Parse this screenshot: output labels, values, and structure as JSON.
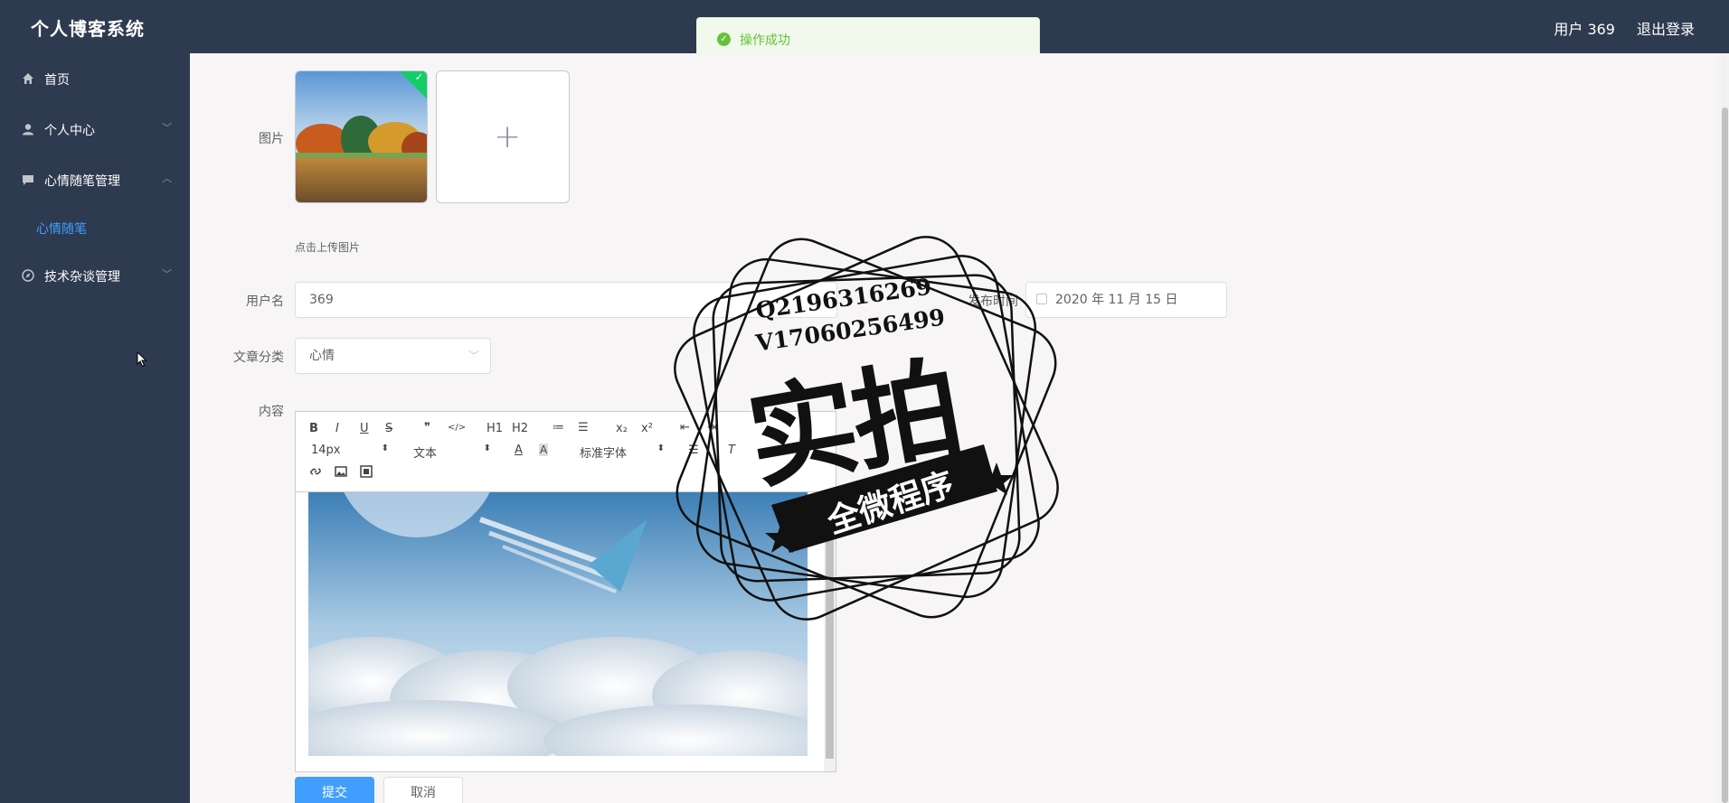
{
  "header": {
    "brand": "个人博客系统",
    "user": "用户 369",
    "logout": "退出登录"
  },
  "toast": {
    "message": "操作成功",
    "type": "success"
  },
  "sidebar": {
    "items": [
      {
        "label": "首页",
        "icon": "home-icon",
        "expandable": false
      },
      {
        "label": "个人中心",
        "icon": "user-icon",
        "expandable": true,
        "expanded": false
      },
      {
        "label": "心情随笔管理",
        "icon": "chat-icon",
        "expandable": true,
        "expanded": true,
        "children": [
          {
            "label": "心情随笔",
            "active": true
          }
        ]
      },
      {
        "label": "技术杂谈管理",
        "icon": "compass-icon",
        "expandable": true,
        "expanded": false
      }
    ]
  },
  "form": {
    "image_label": "图片",
    "upload_tip": "点击上传图片",
    "username_label": "用户名",
    "username_value": "369",
    "publish_time_label": "发布时间",
    "publish_time_value": "2020 年 11 月 15 日",
    "category_label": "文章分类",
    "category_value": "心情",
    "content_label": "内容",
    "submit": "提交",
    "cancel": "取消"
  },
  "editor": {
    "toolbar_row1": [
      "B",
      "I",
      "U",
      "S",
      "❞",
      "</>",
      "H1",
      "H2",
      "≔",
      "☰",
      "x₂",
      "x²",
      "⇤",
      "⇥"
    ],
    "font_size": "14px",
    "block_type": "文本",
    "font_family": "标准字体"
  },
  "watermark": {
    "line1": "Q2196316269",
    "line2": "V17060256499",
    "big": "实拍",
    "ribbon": "全微程序"
  },
  "colors": {
    "sidebar_bg": "#2e3a4f",
    "accent": "#409eff",
    "success": "#67c23a"
  }
}
